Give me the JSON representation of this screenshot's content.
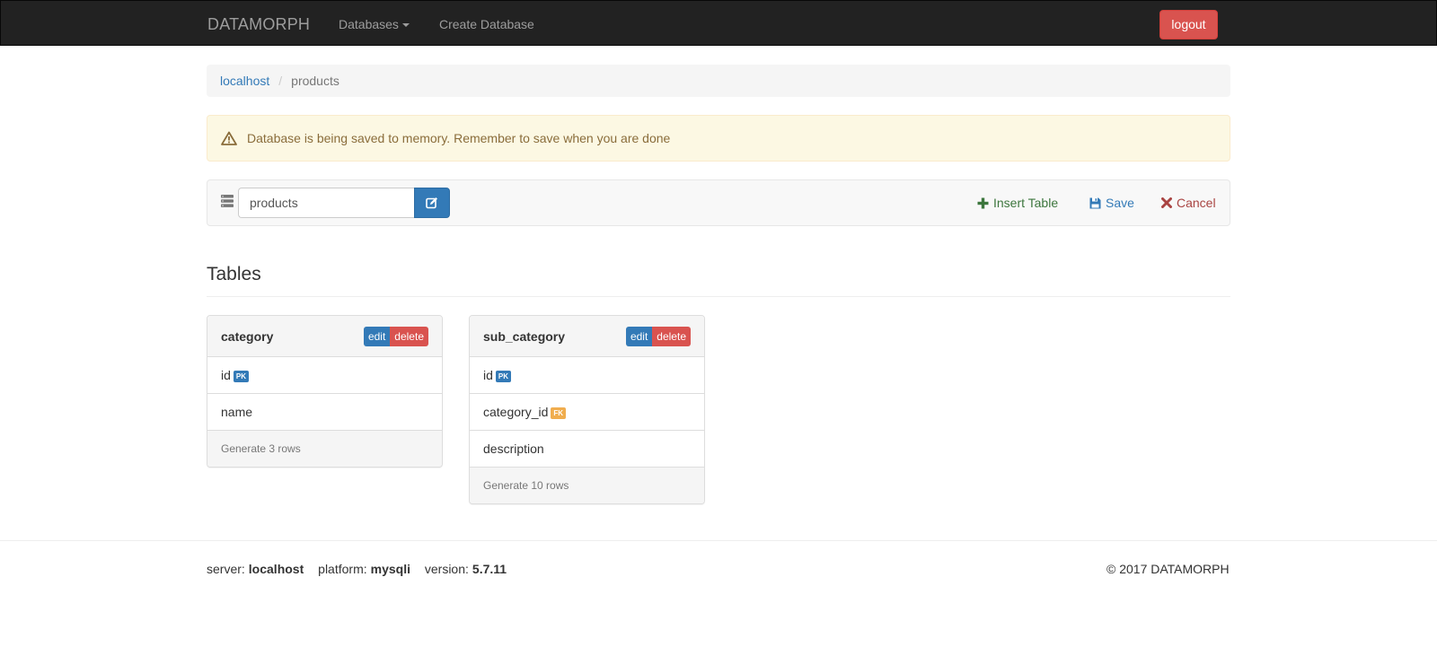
{
  "navbar": {
    "brand": "DATAMORPH",
    "databases_label": "Databases",
    "create_label": "Create Database",
    "logout_label": "logout"
  },
  "breadcrumb": {
    "items": [
      "localhost",
      "products"
    ],
    "separator": "/"
  },
  "alert": {
    "message": "Database is being saved to memory. Remember to save when you are done",
    "icon": "warning-icon"
  },
  "toolbar": {
    "db_name_value": "products",
    "insert_label": "Insert Table",
    "save_label": "Save",
    "cancel_label": "Cancel"
  },
  "section": {
    "title": "Tables"
  },
  "tables": [
    {
      "name": "category",
      "edit_label": "edit",
      "delete_label": "delete",
      "fields": [
        {
          "name": "id",
          "key": "PK"
        },
        {
          "name": "name",
          "key": ""
        }
      ],
      "footer": "Generate 3 rows"
    },
    {
      "name": "sub_category",
      "edit_label": "edit",
      "delete_label": "delete",
      "fields": [
        {
          "name": "id",
          "key": "PK"
        },
        {
          "name": "category_id",
          "key": "FK"
        },
        {
          "name": "description",
          "key": ""
        }
      ],
      "footer": "Generate 10 rows"
    }
  ],
  "footer": {
    "server_label": "server:",
    "server_value": "localhost",
    "platform_label": "platform:",
    "platform_value": "mysqli",
    "version_label": "version:",
    "version_value": "5.7.11",
    "copyright": "© 2017 DATAMORPH"
  },
  "colors": {
    "navbar_bg": "#222222",
    "primary": "#337ab7",
    "danger": "#d9534f",
    "success": "#3c763d",
    "warning_bg": "#fcf8e3",
    "warning_text": "#8a6d3b",
    "fk_badge": "#f0ad4e"
  }
}
